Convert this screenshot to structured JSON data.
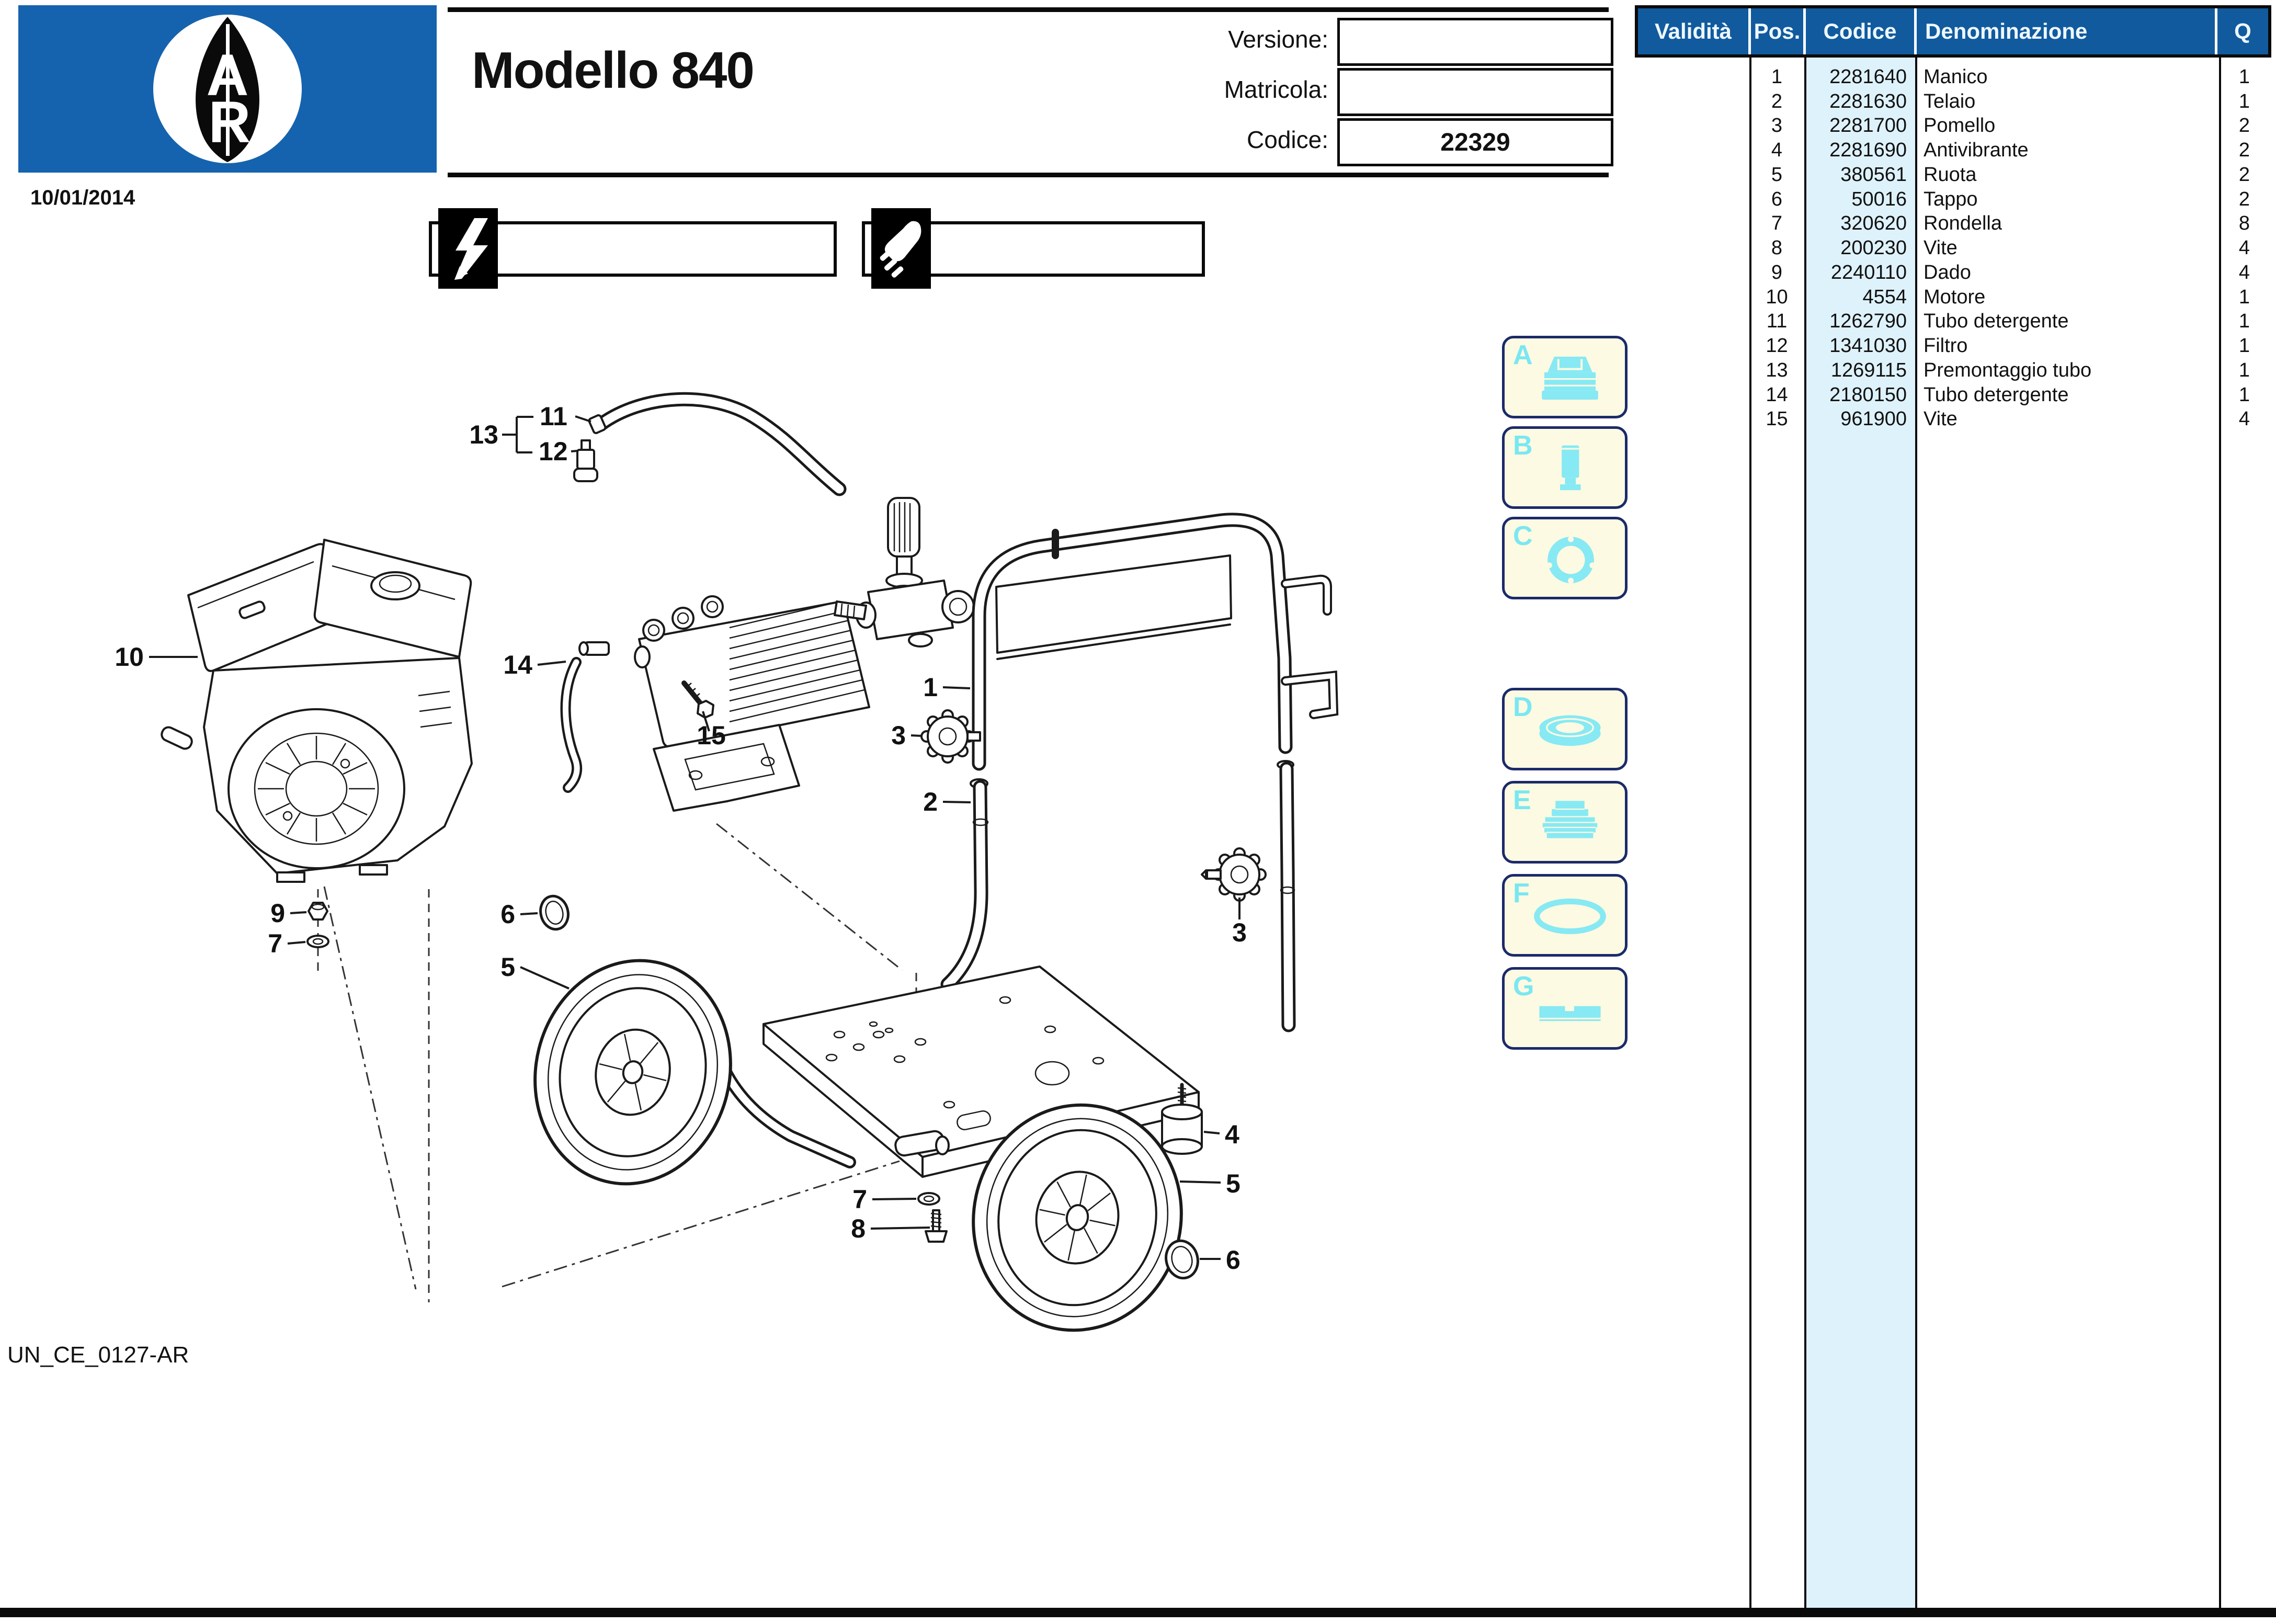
{
  "header": {
    "logo_text": "AR",
    "date": "10/01/2014",
    "title": "Modello 840",
    "fields": [
      {
        "label": "Versione:",
        "value": ""
      },
      {
        "label": "Matricola:",
        "value": ""
      },
      {
        "label": "Codice:",
        "value": "22329"
      }
    ]
  },
  "badges": [
    {
      "icon": "lightning-bolt"
    },
    {
      "icon": "electric-plug"
    }
  ],
  "parts_table": {
    "columns": [
      "Validità",
      "Pos.",
      "Codice",
      "Denominazione",
      "Q"
    ],
    "rows": [
      {
        "validita": "",
        "pos": "1",
        "codice": "2281640",
        "den": "Manico",
        "q": "1"
      },
      {
        "validita": "",
        "pos": "2",
        "codice": "2281630",
        "den": "Telaio",
        "q": "1"
      },
      {
        "validita": "",
        "pos": "3",
        "codice": "2281700",
        "den": "Pomello",
        "q": "2"
      },
      {
        "validita": "",
        "pos": "4",
        "codice": "2281690",
        "den": "Antivibrante",
        "q": "2"
      },
      {
        "validita": "",
        "pos": "5",
        "codice": "380561",
        "den": "Ruota",
        "q": "2"
      },
      {
        "validita": "",
        "pos": "6",
        "codice": "50016",
        "den": "Tappo",
        "q": "2"
      },
      {
        "validita": "",
        "pos": "7",
        "codice": "320620",
        "den": "Rondella",
        "q": "8"
      },
      {
        "validita": "",
        "pos": "8",
        "codice": "200230",
        "den": "Vite",
        "q": "4"
      },
      {
        "validita": "",
        "pos": "9",
        "codice": "2240110",
        "den": "Dado",
        "q": "4"
      },
      {
        "validita": "",
        "pos": "10",
        "codice": "4554",
        "den": "Motore",
        "q": "1"
      },
      {
        "validita": "",
        "pos": "11",
        "codice": "1262790",
        "den": "Tubo detergente",
        "q": "1"
      },
      {
        "validita": "",
        "pos": "12",
        "codice": "1341030",
        "den": "Filtro",
        "q": "1"
      },
      {
        "validita": "",
        "pos": "13",
        "codice": "1269115",
        "den": "Premontaggio tubo",
        "q": "1"
      },
      {
        "validita": "",
        "pos": "14",
        "codice": "2180150",
        "den": "Tubo detergente",
        "q": "1"
      },
      {
        "validita": "",
        "pos": "15",
        "codice": "961900",
        "den": "Vite",
        "q": "4"
      }
    ]
  },
  "kit_boxes": [
    {
      "letter": "A",
      "icon": "pump-valve-cap"
    },
    {
      "letter": "B",
      "icon": "plunger"
    },
    {
      "letter": "C",
      "icon": "flange-gasket"
    },
    {
      "letter": "D",
      "icon": "oil-seal"
    },
    {
      "letter": "E",
      "icon": "stepped-adapter"
    },
    {
      "letter": "F",
      "icon": "o-ring"
    },
    {
      "letter": "G",
      "icon": "key-bar"
    }
  ],
  "diagram": {
    "callouts": [
      {
        "label": "10"
      },
      {
        "label": "13"
      },
      {
        "label": "11"
      },
      {
        "label": "12"
      },
      {
        "label": "14"
      },
      {
        "label": "15"
      },
      {
        "label": "9"
      },
      {
        "label": "7"
      },
      {
        "label": "6"
      },
      {
        "label": "5"
      },
      {
        "label": "1"
      },
      {
        "label": "3"
      },
      {
        "label": "2"
      },
      {
        "label": "3"
      },
      {
        "label": "4"
      },
      {
        "label": "5"
      },
      {
        "label": "7"
      },
      {
        "label": "8"
      },
      {
        "label": "6"
      }
    ]
  },
  "footer": {
    "doc_code": "UN_CE_0127-AR"
  },
  "colors": {
    "brand_blue": "#1563ae",
    "table_header_blue": "#115a9e",
    "codice_column_bg": "#def2fb",
    "kit_box_bg": "#fcfae2",
    "kit_border_navy": "#1b2a69",
    "kit_cyan": "#87e9f3"
  }
}
